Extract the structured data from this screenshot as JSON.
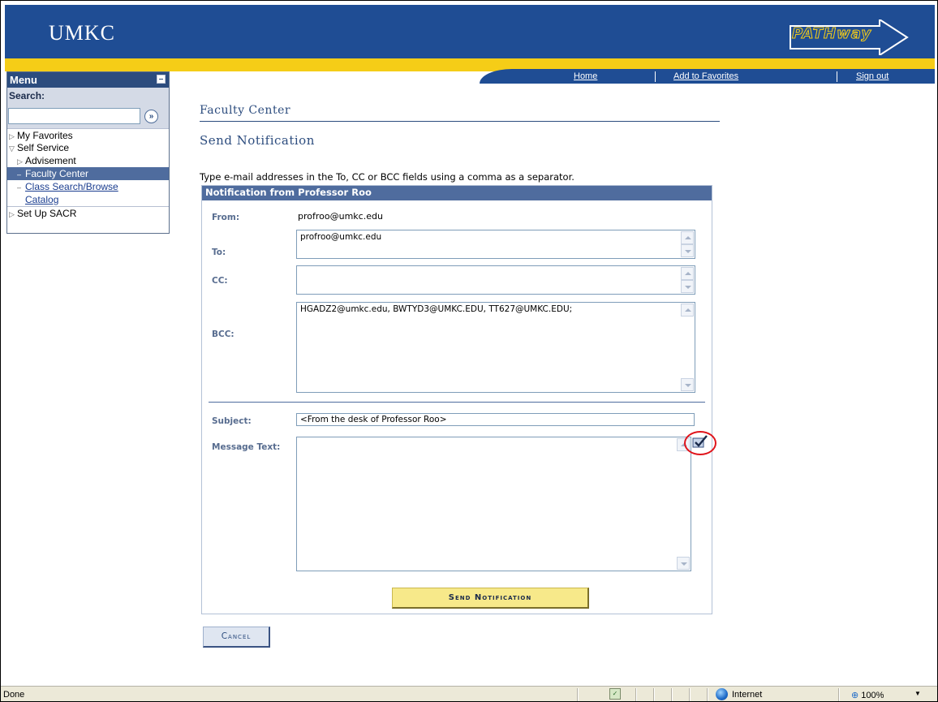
{
  "header": {
    "logo": "UMKC",
    "brand": "PATHway",
    "nav": [
      {
        "label": "Home"
      },
      {
        "label": "Add to Favorites"
      },
      {
        "label": "Sign out"
      }
    ],
    "colors": {
      "primary": "#1f4d94",
      "accent": "#f5cd17"
    }
  },
  "menu": {
    "title": "Menu",
    "search_label": "Search:",
    "search_value": "",
    "go_icon": "double-chevron-right-icon",
    "items": {
      "my_favorites": "My Favorites",
      "self_service": "Self Service",
      "advisement": "Advisement",
      "faculty_center": "Faculty Center",
      "class_search_1": "Class Search/Browse",
      "class_search_2": "Catalog",
      "set_up_sacr": "Set Up SACR"
    }
  },
  "page": {
    "section_title": "Faculty Center",
    "page_title": "Send Notification",
    "instructions": "Type e-mail addresses in the To, CC or BCC fields using a comma as a separator."
  },
  "form": {
    "panel_title": "Notification from Professor Roo",
    "from_label": "From:",
    "from_value": "profroo@umkc.edu",
    "to_label": "To:",
    "to_value": "profroo@umkc.edu",
    "cc_label": "CC:",
    "cc_value": "",
    "bcc_label": "BCC:",
    "bcc_value": "HGADZ2@umkc.edu, BWTYD3@UMKC.EDU, TT627@UMKC.EDU;",
    "subject_label": "Subject:",
    "subject_value": "<From the desk of Professor Roo>",
    "message_label": "Message Text:",
    "message_value": "",
    "send_button": "Send Notification",
    "cancel_button": "Cancel"
  },
  "status_bar": {
    "status": "Done",
    "zone": "Internet",
    "zoom": "100%"
  }
}
